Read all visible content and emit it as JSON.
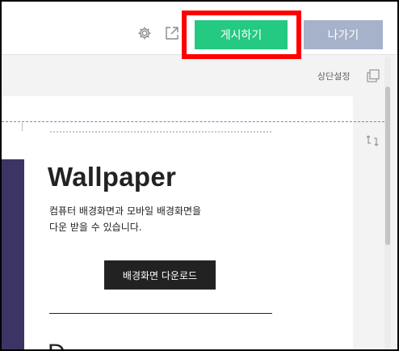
{
  "header": {
    "publish_label": "게시하기",
    "exit_label": "나가기",
    "icons": [
      "gear-icon",
      "external-link-icon"
    ]
  },
  "side_toolbar": {
    "label": "상단설정",
    "icons": [
      "copy-icon",
      "swap-icon"
    ]
  },
  "content": {
    "title": "Wallpaper",
    "description_lines": [
      "컴퓨터 배경화면과 모바일 배경화면을",
      "다운 받을 수 있습니다."
    ],
    "download_label": "배경화면 다운로드",
    "next_heading": "D"
  },
  "colors": {
    "publish": "#24c982",
    "exit": "#a6b2c9",
    "highlight": "#ff0000",
    "strip": "#3c3464"
  }
}
